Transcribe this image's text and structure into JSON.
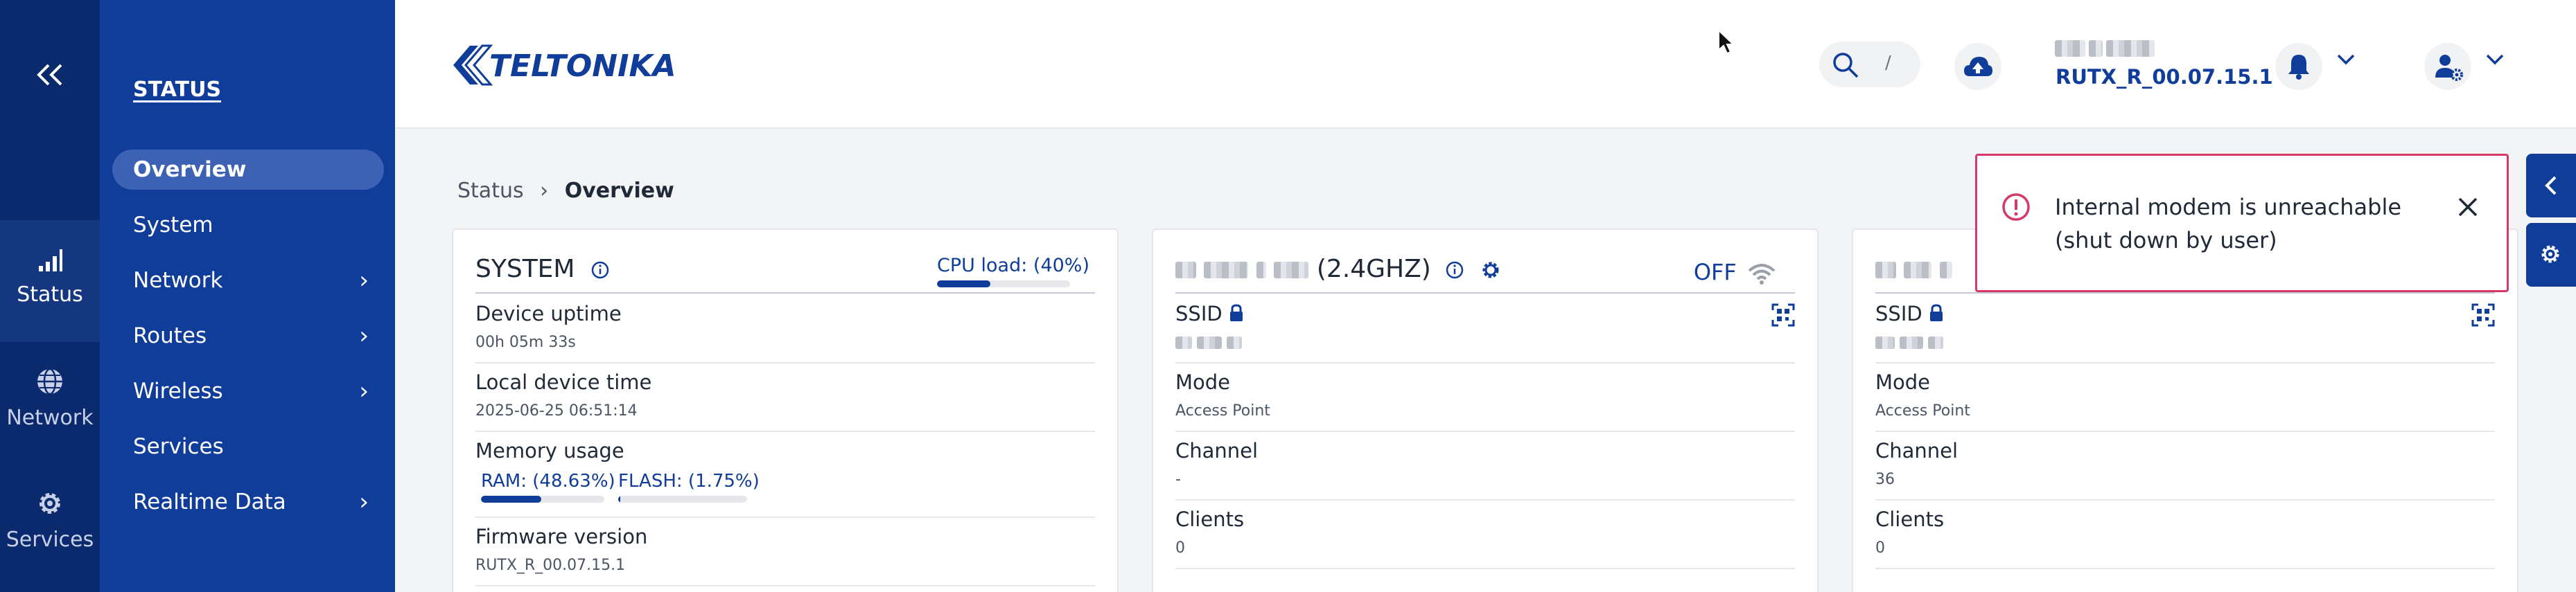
{
  "rail": {
    "items": [
      {
        "label": "Status",
        "icon": "bar-chart-icon",
        "active": true
      },
      {
        "label": "Network",
        "icon": "globe-icon",
        "active": false
      },
      {
        "label": "Services",
        "icon": "gear-icon",
        "active": false
      }
    ]
  },
  "nav": {
    "heading": "STATUS",
    "items": [
      {
        "label": "Overview",
        "active": true,
        "has_submenu": false
      },
      {
        "label": "System",
        "active": false,
        "has_submenu": false
      },
      {
        "label": "Network",
        "active": false,
        "has_submenu": true
      },
      {
        "label": "Routes",
        "active": false,
        "has_submenu": true
      },
      {
        "label": "Wireless",
        "active": false,
        "has_submenu": true
      },
      {
        "label": "Services",
        "active": false,
        "has_submenu": false
      },
      {
        "label": "Realtime Data",
        "active": false,
        "has_submenu": true
      }
    ],
    "chevron": "›"
  },
  "header": {
    "logo_text": "TELTONIKA",
    "search_shortcut": "/",
    "firmware": "RUTX_R_00.07.15.1"
  },
  "breadcrumb": {
    "root": "Status",
    "separator": "›",
    "current": "Overview"
  },
  "system_card": {
    "title": "SYSTEM",
    "cpu_label": "CPU load: (40%)",
    "cpu_percent": 40,
    "rows": [
      {
        "label": "Device uptime",
        "value": "00h 05m 33s"
      },
      {
        "label": "Local device time",
        "value": "2025-06-25 06:51:14"
      },
      {
        "label": "Memory usage",
        "value": ""
      },
      {
        "label": "Firmware version",
        "value": "RUTX_R_00.07.15.1"
      }
    ],
    "ram_label": "RAM: (48.63%)",
    "ram_percent": 48.63,
    "flash_label": "FLASH: (1.75%)",
    "flash_percent": 1.75
  },
  "wifi24_card": {
    "title_suffix": "(2.4GHZ)",
    "status": "OFF",
    "ssid_label": "SSID",
    "rows": [
      {
        "label": "Mode",
        "value": "Access Point"
      },
      {
        "label": "Channel",
        "value": "-"
      },
      {
        "label": "Clients",
        "value": "0"
      }
    ]
  },
  "wifi5_card": {
    "ssid_label": "SSID",
    "rows": [
      {
        "label": "Mode",
        "value": "Access Point"
      },
      {
        "label": "Channel",
        "value": "36"
      },
      {
        "label": "Clients",
        "value": "0"
      }
    ]
  },
  "toast": {
    "message": "Internal modem is unreachable (shut down by user)"
  },
  "colors": {
    "rail_bg": "#0b2a6e",
    "nav_bg": "#0f3d99",
    "accent": "#0f3d99",
    "toast_border": "#d63867"
  }
}
